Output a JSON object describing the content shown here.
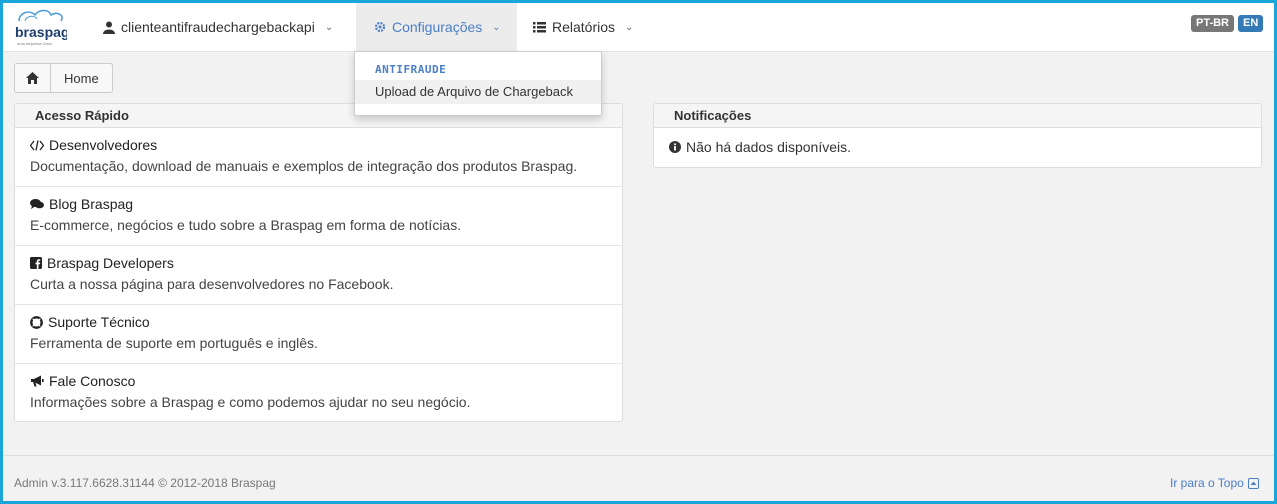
{
  "brand": {
    "name": "braspag",
    "tagline": "uma empresa Cielo"
  },
  "navbar": {
    "user": "clienteantifraudechargebackapi",
    "config": "Configurações",
    "reports": "Relatórios",
    "lang_pt": "PT-BR",
    "lang_en": "EN"
  },
  "dropdown": {
    "header": "ANTIFRAUDE",
    "items": [
      "Upload de Arquivo de Chargeback"
    ]
  },
  "breadcrumb": {
    "home": "Home"
  },
  "quick_access": {
    "title": "Acesso Rápido",
    "items": [
      {
        "icon": "code-icon",
        "title": "Desenvolvedores",
        "desc": "Documentação, download de manuais e exemplos de integração dos produtos Braspag."
      },
      {
        "icon": "comments-icon",
        "title": "Blog Braspag",
        "desc": "E-commerce, negócios e tudo sobre a Braspag em forma de notícias."
      },
      {
        "icon": "facebook-icon",
        "title": "Braspag Developers",
        "desc": "Curta a nossa página para desenvolvedores no Facebook."
      },
      {
        "icon": "lifebuoy-icon",
        "title": "Suporte Técnico",
        "desc": "Ferramenta de suporte em português e inglês."
      },
      {
        "icon": "bullhorn-icon",
        "title": "Fale Conosco",
        "desc": "Informações sobre a Braspag e como podemos ajudar no seu negócio."
      }
    ]
  },
  "notifications": {
    "title": "Notificações",
    "empty": "Não há dados disponíveis."
  },
  "footer": {
    "version": "Admin v.3.117.6628.31144 © 2012-2018 Braspag",
    "top_link": "Ir para o Topo"
  },
  "colors": {
    "accent": "#4b7ec5",
    "frame": "#1aa6d8",
    "lang_en": "#337ab7",
    "lang_pt": "#777777"
  }
}
